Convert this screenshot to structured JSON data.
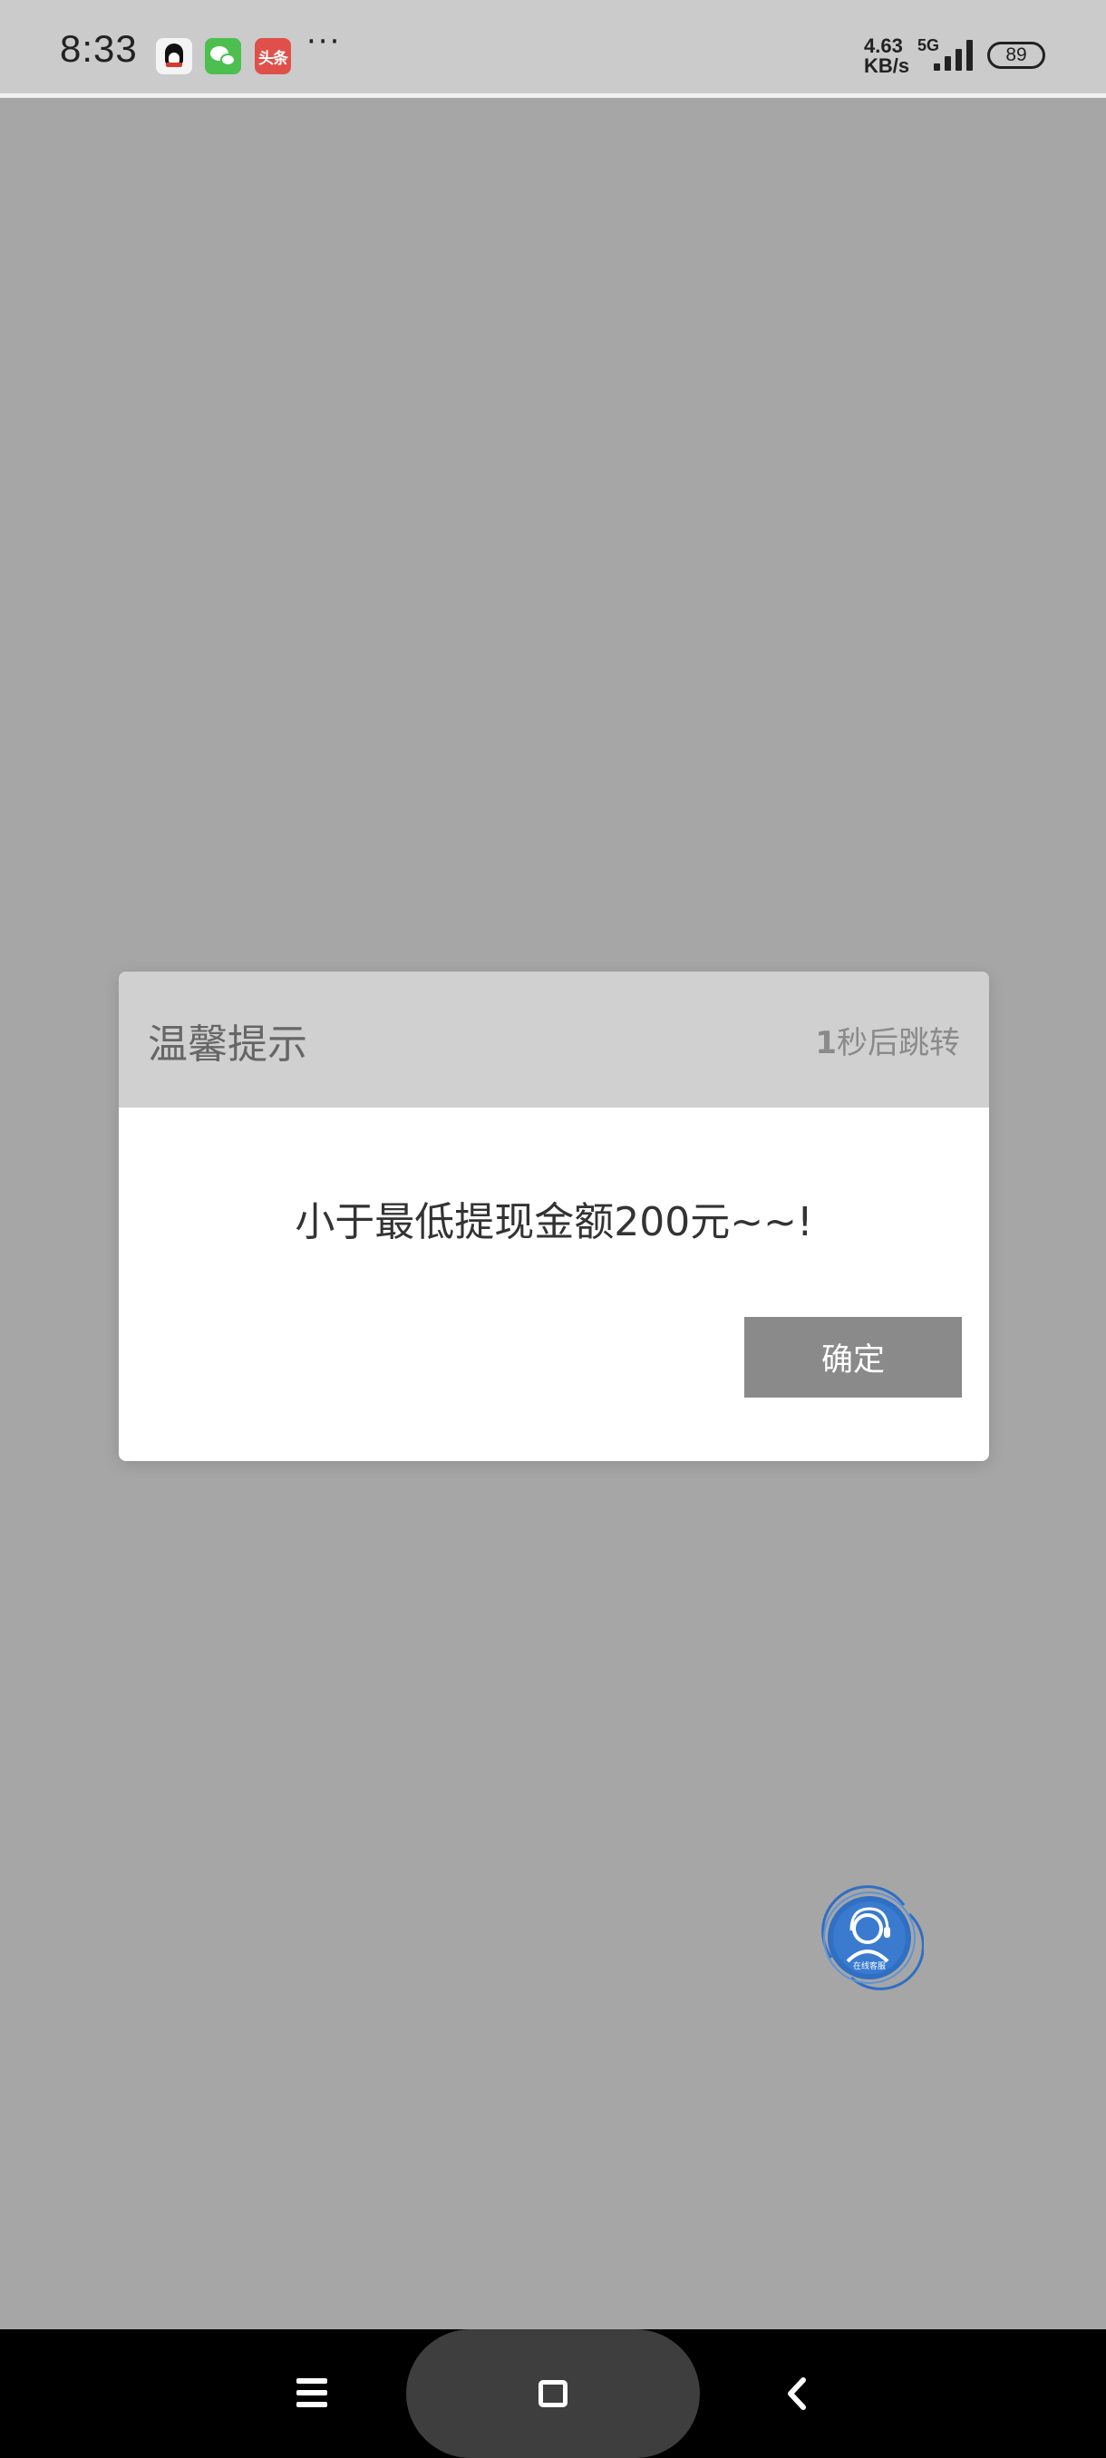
{
  "status_bar": {
    "time": "8:33",
    "notification_icons": [
      "qq-icon",
      "wechat-icon",
      "toutiao-icon"
    ],
    "toutiao_label": "头条",
    "more": "···",
    "net_speed_value": "4.63",
    "net_speed_unit": "KB/s",
    "network_type": "5G",
    "battery": "89"
  },
  "dialog": {
    "title": "温馨提示",
    "countdown_number": "1",
    "countdown_text": "秒后跳转",
    "message": "小于最低提现金额200元~~!",
    "confirm_label": "确定"
  },
  "floating_button": {
    "icon": "customer-service-icon",
    "label": "在线客服"
  },
  "nav_bar": {
    "buttons": [
      "menu-icon",
      "home-icon",
      "back-icon"
    ]
  },
  "colors": {
    "backdrop": "#a6a6a6",
    "dialog_header": "#d0d0d0",
    "confirm_button": "#8a8a8a",
    "service_button": "#2f6fc4"
  }
}
